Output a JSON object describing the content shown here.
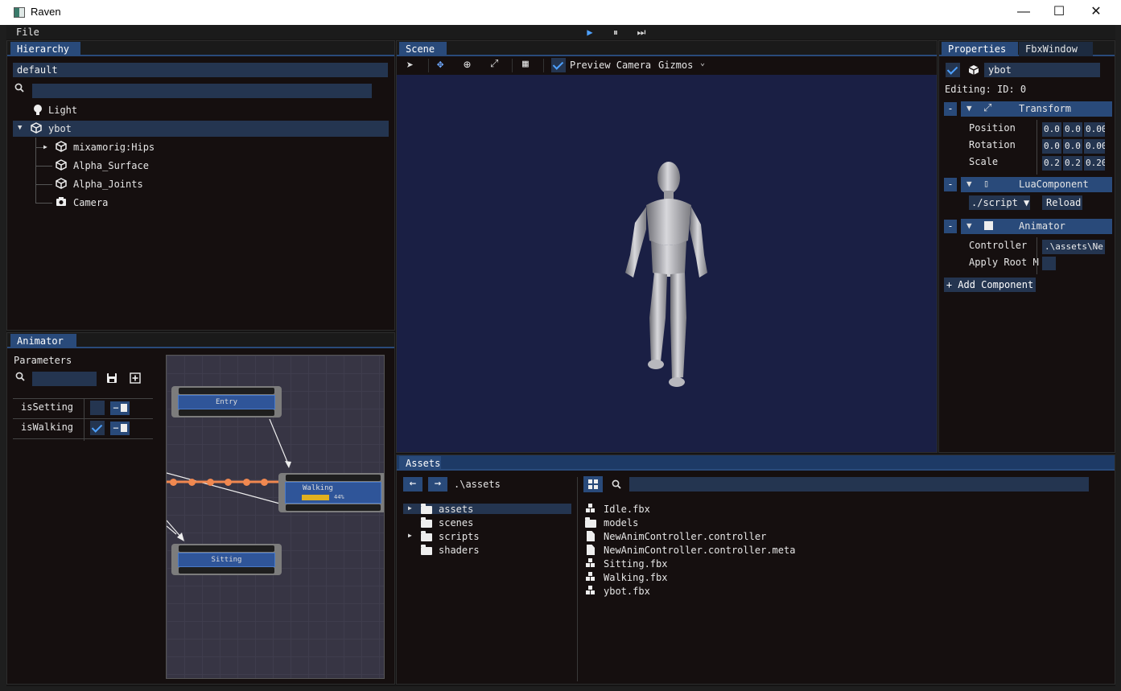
{
  "window": {
    "title": "Raven",
    "minimize": "—",
    "maximize": "☐",
    "close": "✕"
  },
  "menu": {
    "file": "File"
  },
  "playback": {
    "play": "▶",
    "pause": "⏸",
    "step": "⏭"
  },
  "hierarchy": {
    "tab": "Hierarchy",
    "scene_name": "default",
    "search_placeholder": "",
    "items": [
      {
        "label": "Light",
        "icon": "lightbulb-icon"
      },
      {
        "label": "ybot",
        "icon": "cube-icon",
        "expanded": true,
        "selected": true
      },
      {
        "label": "mixamorig:Hips",
        "icon": "cube-icon"
      },
      {
        "label": "Alpha_Surface",
        "icon": "cube-icon"
      },
      {
        "label": "Alpha_Joints",
        "icon": "cube-icon"
      },
      {
        "label": "Camera",
        "icon": "camera-icon"
      }
    ]
  },
  "animator": {
    "tab": "Animator",
    "parameters_label": "Parameters",
    "params": [
      {
        "name": "isSetting",
        "value": false
      },
      {
        "name": "isWalking",
        "value": true
      }
    ],
    "nodes": {
      "entry": "Entry",
      "walking": "Walking",
      "walking_progress": "44%",
      "sitting": "Sitting"
    },
    "accent": "#f08850"
  },
  "scene": {
    "tab": "Scene",
    "preview_camera": "Preview Camera",
    "gizmos": "Gizmos",
    "background": "#1a1f44"
  },
  "properties": {
    "tab": "Properties",
    "tab2": "FbxWindow",
    "object_name": "ybot",
    "editing": "Editing: ID: 0",
    "transform": {
      "title": "Transform",
      "position_label": "Position",
      "position": [
        "0.0",
        "0.0",
        "0.00"
      ],
      "rotation_label": "Rotation",
      "rotation": [
        "0.0",
        "0.0",
        "0.00"
      ],
      "scale_label": "Scale",
      "scale": [
        "0.2",
        "0.2",
        "0.20"
      ]
    },
    "lua": {
      "title": "LuaComponent",
      "script": "./script",
      "reload": "Reload"
    },
    "animator": {
      "title": "Animator",
      "controller_label": "Controller",
      "controller_value": ".\\assets\\Ne",
      "apply_root_label": "Apply Root M"
    },
    "add_component": "+ Add Component",
    "collapse": "-"
  },
  "assets": {
    "tab": "Assets",
    "path": ".\\assets",
    "folders": [
      {
        "name": "assets",
        "expandable": true,
        "selected": true
      },
      {
        "name": "scenes",
        "expandable": false
      },
      {
        "name": "scripts",
        "expandable": true
      },
      {
        "name": "shaders",
        "expandable": false
      }
    ],
    "files": [
      {
        "name": "Idle.fbx",
        "type": "mesh"
      },
      {
        "name": "models",
        "type": "folder"
      },
      {
        "name": "NewAnimController.controller",
        "type": "file"
      },
      {
        "name": "NewAnimController.controller.meta",
        "type": "file"
      },
      {
        "name": "Sitting.fbx",
        "type": "mesh"
      },
      {
        "name": "Walking.fbx",
        "type": "mesh"
      },
      {
        "name": "ybot.fbx",
        "type": "mesh"
      }
    ]
  }
}
